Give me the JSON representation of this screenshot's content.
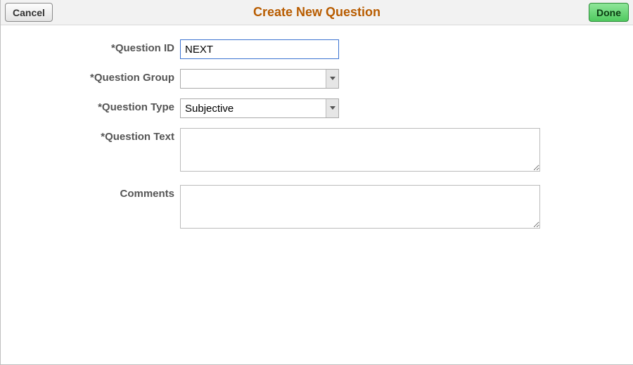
{
  "header": {
    "title": "Create New Question",
    "cancel_label": "Cancel",
    "done_label": "Done"
  },
  "form": {
    "question_id": {
      "label": "*Question ID",
      "value": "NEXT"
    },
    "question_group": {
      "label": "*Question Group",
      "value": ""
    },
    "question_type": {
      "label": "*Question Type",
      "value": "Subjective"
    },
    "question_text": {
      "label": "*Question Text",
      "value": ""
    },
    "comments": {
      "label": "Comments",
      "value": ""
    }
  }
}
